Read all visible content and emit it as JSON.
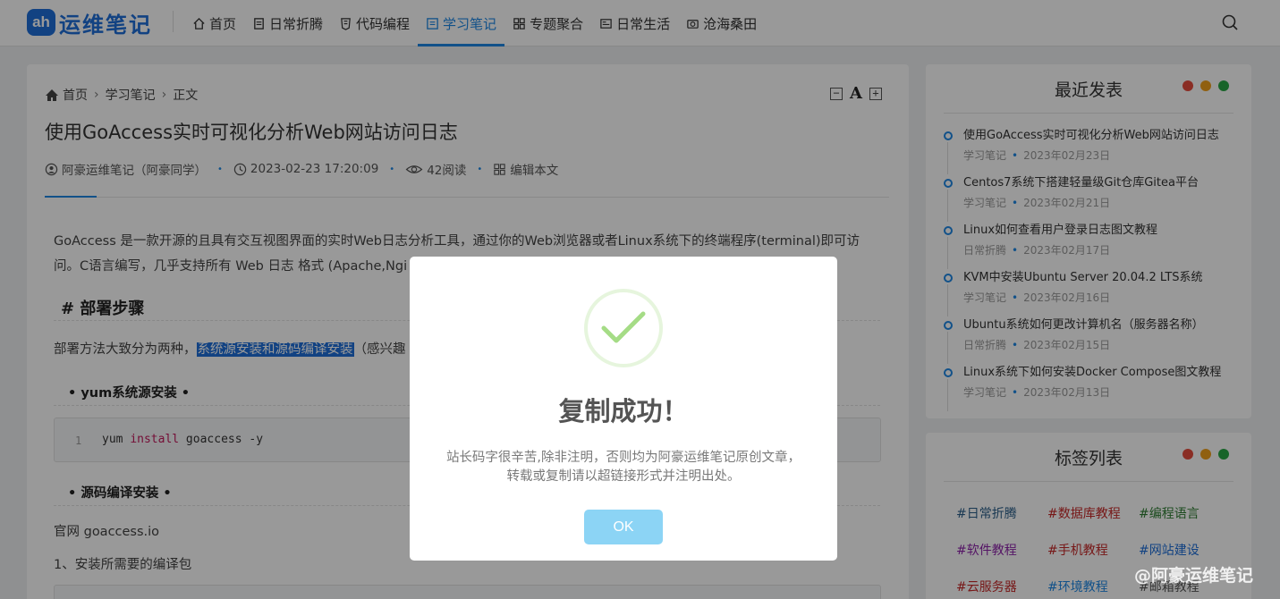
{
  "site": {
    "logo_badge": "ah",
    "logo_text": "运维笔记"
  },
  "nav": [
    {
      "label": "首页",
      "icon": "home-icon"
    },
    {
      "label": "日常折腾",
      "icon": "document-icon"
    },
    {
      "label": "代码编程",
      "icon": "html5-icon"
    },
    {
      "label": "学习笔记",
      "icon": "notes-icon",
      "active": true
    },
    {
      "label": "专题聚合",
      "icon": "grid-icon"
    },
    {
      "label": "日常生活",
      "icon": "news-icon"
    },
    {
      "label": "沧海桑田",
      "icon": "camera-icon"
    }
  ],
  "breadcrumb": {
    "home": "首页",
    "category": "学习笔记",
    "current": "正文"
  },
  "font_tools": {
    "decrease": "−",
    "letter": "A",
    "increase": "+"
  },
  "post": {
    "title": "使用GoAccess实时可视化分析Web网站访问日志",
    "author": "阿豪运维笔记（阿豪同学）",
    "datetime": "2023-02-23 17:20:09",
    "views": "42阅读",
    "edit": "编辑本文",
    "intro_line1": "GoAccess 是一款开源的且具有交互视图界面的实时Web日志分析工具，通过你的Web浏览器或者Linux系统下的终端程序(terminal)即可访",
    "intro_line2": "问。C语言编写，几乎支持所有 Web 日志 格式 (Apache,Ngi",
    "h2": "# 部署步骤",
    "deploy_prefix": "部署方法大致分为两种，",
    "deploy_highlight": "系统源安装和源码编译安装",
    "deploy_suffix": "（感兴趣",
    "h3_yum": "• yum系统源安装 •",
    "code_line_no": "1",
    "code_cmd1": "yum ",
    "code_kw": "install",
    "code_cmd2": " goaccess -y",
    "h3_src": "• 源码编译安装 •",
    "site_line": "官网 goaccess.io",
    "step1": "1、安装所需要的编译包"
  },
  "recent": {
    "title": "最近发表",
    "items": [
      {
        "title": "使用GoAccess实时可视化分析Web网站访问日志",
        "category": "学习笔记",
        "date": "2023年02月23日"
      },
      {
        "title": "Centos7系统下搭建轻量级Git仓库Gitea平台",
        "category": "学习笔记",
        "date": "2023年02月21日"
      },
      {
        "title": "Linux如何查看用户登录日志图文教程",
        "category": "日常折腾",
        "date": "2023年02月17日"
      },
      {
        "title": "KVM中安装Ubuntu Server 20.04.2 LTS系统",
        "category": "学习笔记",
        "date": "2023年02月16日"
      },
      {
        "title": "Ubuntu系统如何更改计算机名（服务器名称）",
        "category": "日常折腾",
        "date": "2023年02月15日"
      },
      {
        "title": "Linux系统下如何安装Docker Compose图文教程",
        "category": "学习笔记",
        "date": "2023年02月13日"
      }
    ]
  },
  "tags": {
    "title": "标签列表",
    "items": [
      {
        "label": "#日常折腾",
        "color": "#2c5f8a"
      },
      {
        "label": "#数据库教程",
        "color": "#c62828"
      },
      {
        "label": "#编程语言",
        "color": "#2e7d32"
      },
      {
        "label": "#软件教程",
        "color": "#8e24aa"
      },
      {
        "label": "#手机教程",
        "color": "#c62828"
      },
      {
        "label": "#网站建设",
        "color": "#1e6fd9"
      },
      {
        "label": "#云服务器",
        "color": "#c62828"
      },
      {
        "label": "#环境教程",
        "color": "#1e88e5"
      },
      {
        "label": "#邮箱教程",
        "color": "#555555"
      }
    ]
  },
  "dialog": {
    "title": "复制成功！",
    "text_line1": "站长码字很辛苦,除非注明，否则均为阿豪运维笔记原创文章，",
    "text_line2": "转载或复制请以超链接形式并注明出处。",
    "ok": "OK"
  },
  "watermark": "@阿豪运维笔记",
  "colors": {
    "accent": "#1e88e5",
    "ok_button": "#8cd4f5",
    "dot_red": "#e74c3c",
    "dot_yellow": "#f1a01b",
    "dot_green": "#28a745"
  }
}
